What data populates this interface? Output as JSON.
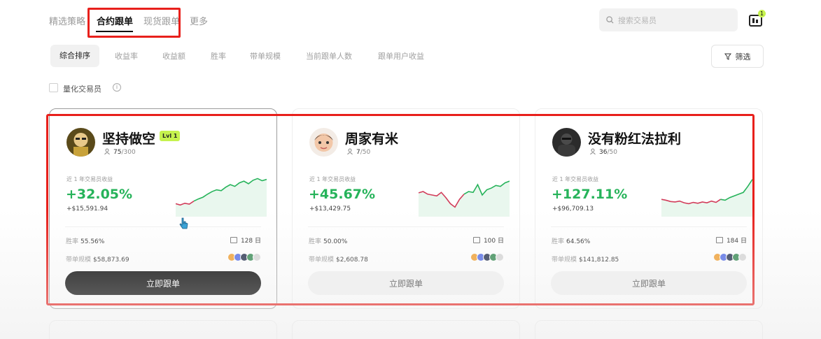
{
  "nav": {
    "tabs": [
      "精选策略",
      "合约跟单",
      "现货跟单",
      "更多"
    ],
    "active_tab": "合约跟单"
  },
  "search": {
    "placeholder": "搜索交易员"
  },
  "notification_count": "1",
  "sort": {
    "options": [
      "综合排序",
      "收益率",
      "收益额",
      "胜率",
      "带单规模",
      "当前跟单人数",
      "跟单用户收益"
    ],
    "active": "综合排序"
  },
  "filter_label": "筛选",
  "quant_filter_label": "量化交易员",
  "card_labels": {
    "pnl_label": "近 1 年交易员收益",
    "winrate_label": "胜率",
    "aum_label": "带单规模",
    "follow_button": "立即跟单"
  },
  "traders": [
    {
      "name": "坚持做空",
      "level": "Lvl 1",
      "followers": "75",
      "max_followers": "/300",
      "pnl_pct": "+32.05%",
      "pnl_abs": "+$15,591.94",
      "win_rate": "55.56%",
      "days": "128 日",
      "aum": "$58,873.69",
      "button_style": "dark",
      "sparkline": [
        0.3,
        0.27,
        0.31,
        0.29,
        0.36,
        0.41,
        0.45,
        0.52,
        0.58,
        0.62,
        0.6,
        0.68,
        0.74,
        0.7,
        0.78,
        0.82,
        0.76,
        0.84,
        0.88,
        0.83,
        0.86
      ],
      "negative_until": 4
    },
    {
      "name": "周家有米",
      "level": "",
      "followers": "7",
      "max_followers": "/50",
      "pnl_pct": "+45.67%",
      "pnl_abs": "+$13,429.75",
      "win_rate": "50.00%",
      "days": "100 日",
      "aum": "$2,608.78",
      "button_style": "light",
      "sparkline": [
        0.55,
        0.58,
        0.52,
        0.5,
        0.48,
        0.56,
        0.44,
        0.3,
        0.22,
        0.4,
        0.52,
        0.58,
        0.56,
        0.74,
        0.5,
        0.62,
        0.66,
        0.72,
        0.7,
        0.78,
        0.82
      ],
      "negative_until": 10
    },
    {
      "name": "没有粉红法拉利",
      "level": "",
      "followers": "36",
      "max_followers": "/50",
      "pnl_pct": "+127.11%",
      "pnl_abs": "+$96,709.13",
      "win_rate": "64.56%",
      "days": "184 日",
      "aum": "$141,812.85",
      "button_style": "light",
      "sparkline": [
        0.4,
        0.38,
        0.35,
        0.34,
        0.36,
        0.32,
        0.3,
        0.33,
        0.31,
        0.34,
        0.32,
        0.36,
        0.33,
        0.4,
        0.38,
        0.44,
        0.48,
        0.52,
        0.56,
        0.7,
        0.86
      ],
      "negative_until": 13
    }
  ],
  "coin_colors": [
    "#f2a33a",
    "#5b73e8",
    "#2f3a55",
    "#3f8f5a",
    "#d9d9d9"
  ],
  "colors": {
    "positive": "#26b35a",
    "negative": "#d23c5a",
    "highlight_red": "#e8201c",
    "level_badge": "#c6f24e"
  }
}
